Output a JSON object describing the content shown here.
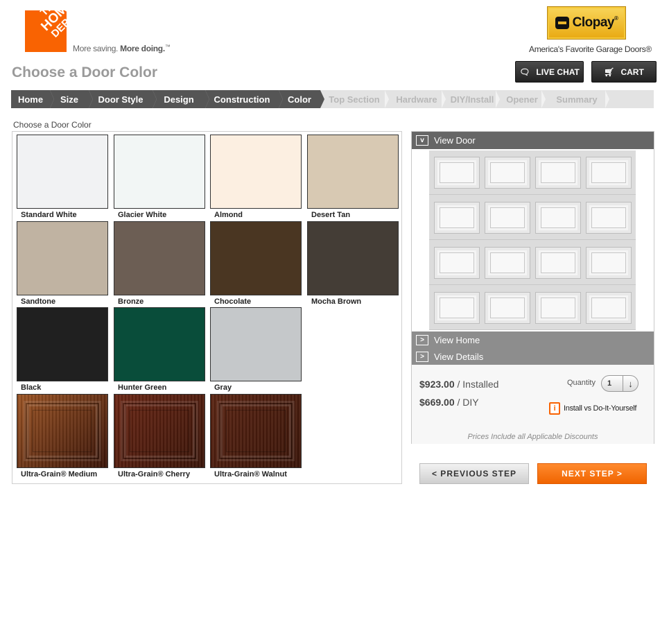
{
  "header": {
    "hd_logo_lines": [
      "THE",
      "HOME",
      "DEPOT"
    ],
    "tagline_light": "More saving.",
    "tagline_bold": "More doing.",
    "tagline_mark": "™",
    "clopay_name": "Clopay",
    "clopay_mark": "®",
    "clopay_tagline": "America's Favorite Garage Doors®"
  },
  "page_title": "Choose a Door Color",
  "top_buttons": {
    "live_chat": "LIVE CHAT",
    "cart": "CART"
  },
  "steps": [
    {
      "label": "Home",
      "state": "done"
    },
    {
      "label": "Size",
      "state": "done"
    },
    {
      "label": "Door Style",
      "state": "done"
    },
    {
      "label": "Design",
      "state": "done"
    },
    {
      "label": "Construction",
      "state": "done"
    },
    {
      "label": "Color",
      "state": "done"
    },
    {
      "label": "Top Section",
      "state": "todo"
    },
    {
      "label": "Hardware",
      "state": "todo"
    },
    {
      "label": "DIY/Install",
      "state": "todo"
    },
    {
      "label": "Opener",
      "state": "todo"
    },
    {
      "label": "Summary",
      "state": "todo"
    }
  ],
  "color_section_label": "Choose a Door Color",
  "colors": [
    {
      "name": "Standard White",
      "hex": "#f1f2f3"
    },
    {
      "name": "Glacier White",
      "hex": "#f2f6f5"
    },
    {
      "name": "Almond",
      "hex": "#fcefe1"
    },
    {
      "name": "Desert Tan",
      "hex": "#d8c9b3"
    },
    {
      "name": "Sandtone",
      "hex": "#c0b3a2"
    },
    {
      "name": "Bronze",
      "hex": "#6c5e54"
    },
    {
      "name": "Chocolate",
      "hex": "#4a3622"
    },
    {
      "name": "Mocha Brown",
      "hex": "#443d36"
    },
    {
      "name": "Black",
      "hex": "#202020"
    },
    {
      "name": "Hunter Green",
      "hex": "#094d3a"
    },
    {
      "name": "Gray",
      "hex": "#c5c8ca"
    },
    {
      "name": "Ultra-Grain® Medium",
      "hex": "#9c5424",
      "wood": true
    },
    {
      "name": "Ultra-Grain® Cherry",
      "hex": "#6a2614",
      "wood": true
    },
    {
      "name": "Ultra-Grain® Walnut",
      "hex": "#5a2412",
      "wood": true
    }
  ],
  "view_panel": {
    "toggle_open": "v",
    "toggle_closed": ">",
    "view_door": "View Door",
    "view_home": "View Home",
    "view_details": "View Details",
    "installed_price": "$923.00",
    "installed_label": " / Installed",
    "diy_price": "$669.00",
    "diy_label": " / DIY",
    "quantity_label": "Quantity",
    "quantity_value": "1",
    "install_vs_diy": "Install vs Do-It-Yourself",
    "discount_note": "Prices Include all Applicable Discounts"
  },
  "nav": {
    "previous": "<   PREVIOUS STEP",
    "next": "NEXT STEP   >"
  }
}
